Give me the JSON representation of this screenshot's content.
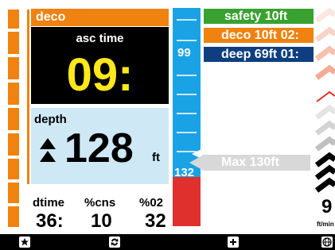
{
  "deco": {
    "label": "deco"
  },
  "ascent": {
    "label": "asc time",
    "value": "09:"
  },
  "depth": {
    "label": "depth",
    "value": "128",
    "unit": "ft"
  },
  "stats": {
    "dtime": {
      "label": "dtime",
      "value": "36:"
    },
    "cns": {
      "label": "%cns",
      "value": "10"
    },
    "o2": {
      "label": "%02",
      "value": "32"
    }
  },
  "scale": {
    "label_top": "99",
    "label_bottom": "132"
  },
  "messages": {
    "safety": "safety 10ft",
    "deco": "deco 10ft 02:",
    "deep": "deep 69ft 01:"
  },
  "max_depth": "Max 130ft",
  "ascent_rate": {
    "value": "9",
    "unit": "ft/min"
  },
  "footer_icons": [
    "star-icon",
    "swap-icon",
    "plus-icon",
    "globe-icon"
  ],
  "colors": {
    "orange": "#f0820f",
    "yellow": "#ffe81a",
    "blue": "#19a3e5",
    "light_blue": "#cfe8f6",
    "red": "#e0302d",
    "green": "#38a12f",
    "navy": "#0d3f80"
  }
}
